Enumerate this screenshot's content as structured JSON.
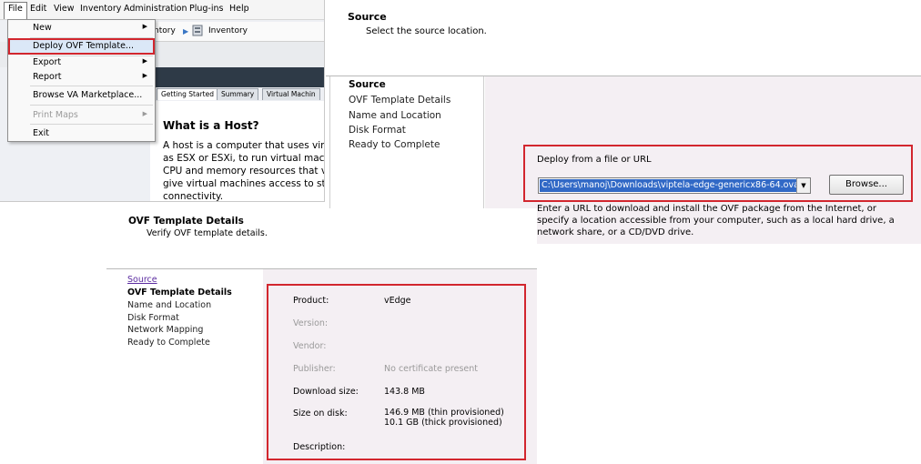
{
  "vsphere": {
    "menubar": [
      "File",
      "Edit",
      "View",
      "Inventory",
      "Administration",
      "Plug-ins",
      "Help"
    ],
    "breadcrumb": [
      "ntory",
      "Inventory"
    ],
    "file_menu": {
      "new": "New",
      "deploy_ovf": "Deploy OVF Template...",
      "export": "Export",
      "report": "Report",
      "browse_marketplace": "Browse VA Marketplace...",
      "print_maps": "Print Maps",
      "exit": "Exit"
    },
    "tabs": [
      "Getting Started",
      "Summary",
      "Virtual Machin"
    ],
    "host_title": "What is a Host?",
    "host_description": [
      "A host is a computer that uses virtu",
      "as ESX or ESXi, to run virtual machi",
      "CPU and memory resources that vir",
      "give virtual machines access to stor",
      "connectivity."
    ]
  },
  "source_page": {
    "title": "Source",
    "subtitle": "Select the source location.",
    "steps": [
      "Source",
      "OVF Template Details",
      "Name and Location",
      "Disk Format",
      "Ready to Complete"
    ],
    "deploy_label": "Deploy from a file or URL",
    "path_value": "C:\\Users\\manoj\\Downloads\\viptela-edge-genericx86-64.ova",
    "browse_label": "Browse...",
    "help_text": [
      "Enter a URL to download and install the OVF package from the Internet, or",
      "specify a location accessible from your computer, such as a local hard drive, a",
      "network share, or a CD/DVD drive."
    ]
  },
  "ovf_details_page": {
    "title": "OVF Template Details",
    "subtitle": "Verify OVF template details.",
    "steps": [
      "Source",
      "OVF Template Details",
      "Name and Location",
      "Disk Format",
      "Network Mapping",
      "Ready to Complete"
    ],
    "fields": {
      "product_label": "Product:",
      "product_value": "vEdge",
      "version_label": "Version:",
      "vendor_label": "Vendor:",
      "publisher_label": "Publisher:",
      "publisher_value": "No certificate present",
      "download_size_label": "Download size:",
      "download_size_value": "143.8 MB",
      "size_on_disk_label": "Size on disk:",
      "size_on_disk_thin": "146.9 MB (thin provisioned)",
      "size_on_disk_thick": "10.1 GB (thick provisioned)",
      "description_label": "Description:"
    }
  },
  "colors": {
    "highlight_red": "#d2262e",
    "selection_blue": "#3169c6",
    "wizard_background": "#f4eff3",
    "link_purple": "#5b2ca0"
  }
}
